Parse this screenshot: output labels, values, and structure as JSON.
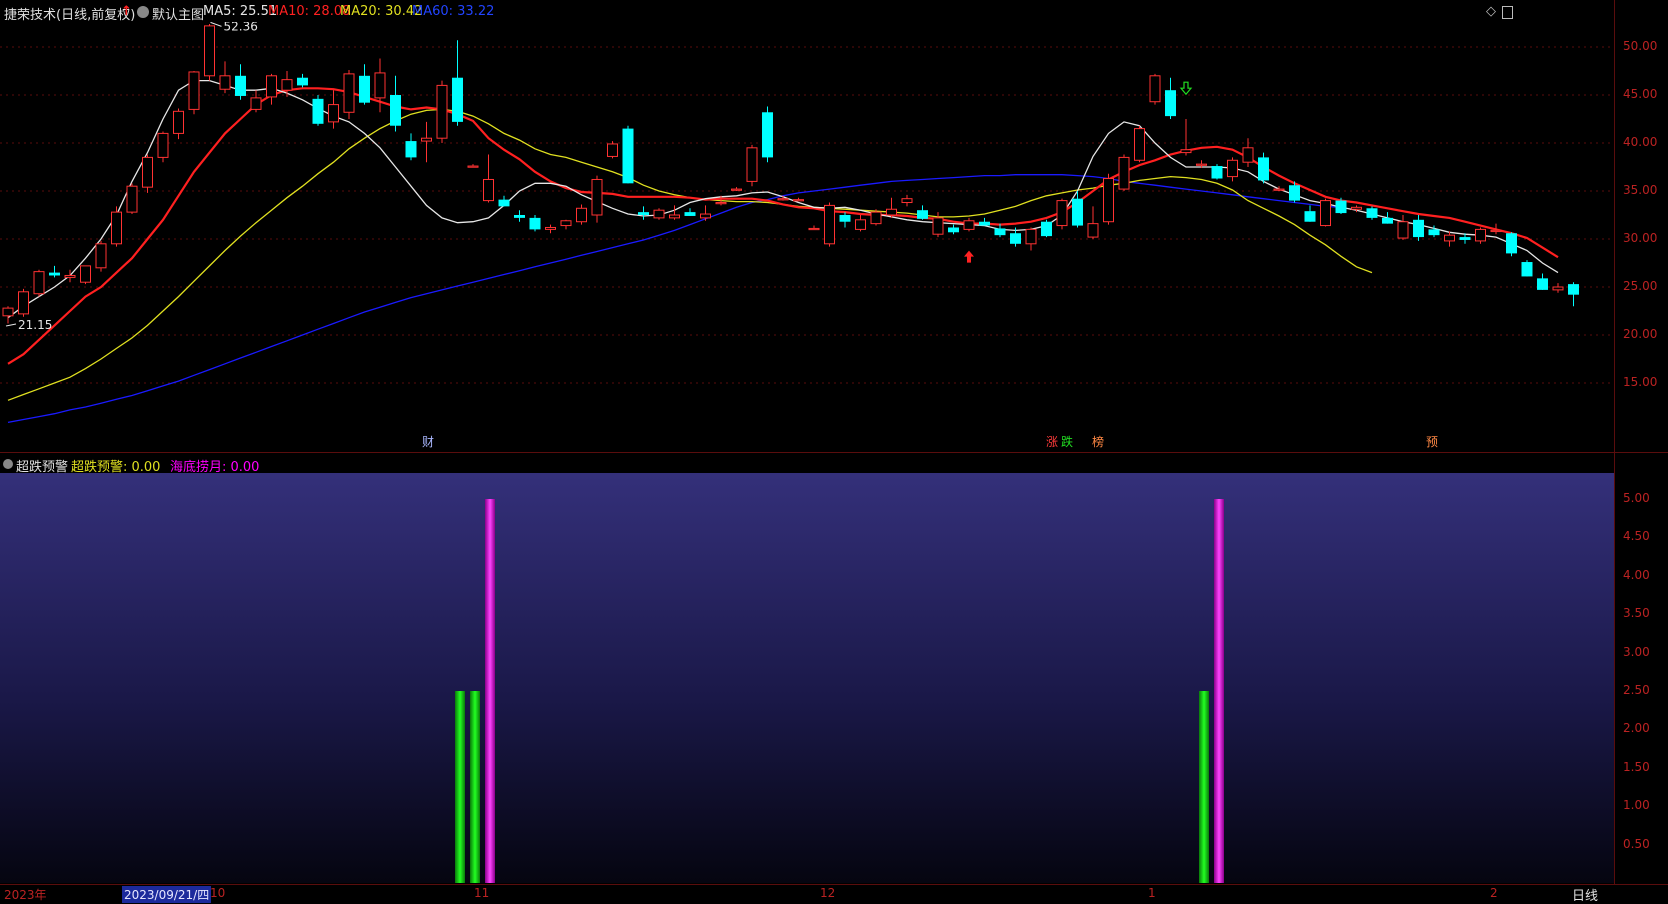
{
  "header": {
    "stock_title": "捷荣技术(日线,前复权)",
    "template_label": "默认主图",
    "ma5": "MA5: 25.51",
    "ma10": "MA10: 28.08",
    "ma20": "MA20: 30.42",
    "ma60": "MA60: 33.22"
  },
  "indicator": {
    "name": "超跌预警",
    "value1": "超跌预警: 0.00",
    "value2": "海底捞月: 0.00"
  },
  "right_axis": {
    "price_ticks": [
      "50.00",
      "45.00",
      "40.00",
      "35.00",
      "30.00",
      "25.00",
      "20.00",
      "15.00"
    ],
    "indicator_ticks": [
      "5.00",
      "4.50",
      "4.00",
      "3.50",
      "3.00",
      "2.50",
      "2.00",
      "1.50",
      "1.00",
      "0.50"
    ]
  },
  "bottom": {
    "year": "2023年",
    "cursor_date": "2023/09/21/四",
    "month_labels": [
      "10",
      "11",
      "12",
      "1",
      "2"
    ],
    "period": "日线"
  },
  "markers": {
    "high_label": "52.36",
    "low_label": "21.15",
    "event_cai": "财",
    "event_zhang": "涨",
    "event_die": "跌",
    "event_bang": "榜",
    "event_yu": "预"
  },
  "colors": {
    "up": "#ff3232",
    "down": "#00ffff",
    "ma5": "#e6e6e6",
    "ma10": "#ff2020",
    "ma20": "#e0e020",
    "ma60": "#1a1aff",
    "green_bar": "#00cc00",
    "magenta_bar": "#ff00ff"
  },
  "chart_data": {
    "type": "candlestick",
    "y_range": [
      10.5,
      55
    ],
    "candles": [
      [
        22,
        23,
        21.2,
        22.8
      ],
      [
        22.2,
        24.8,
        21.9,
        24.5
      ],
      [
        24.3,
        26.8,
        24,
        26.6
      ],
      [
        26.5,
        27.2,
        26,
        26.2
      ],
      [
        26,
        26.8,
        25.5,
        26.2
      ],
      [
        25.5,
        27.2,
        25.3,
        27.2
      ],
      [
        27,
        29.8,
        26.6,
        29.5
      ],
      [
        29.5,
        33.4,
        29.2,
        32.8
      ],
      [
        32.8,
        35.8,
        32.6,
        35.5
      ],
      [
        35.4,
        38.8,
        34.8,
        38.5
      ],
      [
        38.5,
        41.2,
        38,
        41
      ],
      [
        41,
        43.6,
        40.4,
        43.3
      ],
      [
        43.5,
        47.5,
        43,
        47.4
      ],
      [
        47,
        52.4,
        46.5,
        52.2
      ],
      [
        45.6,
        48.5,
        45.2,
        47
      ],
      [
        47,
        48.2,
        44.5,
        44.9
      ],
      [
        43.5,
        45.5,
        43.2,
        44.7
      ],
      [
        44.8,
        47.2,
        44,
        47
      ],
      [
        45.5,
        47.5,
        44.8,
        46.6
      ],
      [
        46.8,
        47.2,
        45.8,
        46
      ],
      [
        44.6,
        45,
        41.8,
        42
      ],
      [
        42.2,
        45.5,
        41.5,
        44
      ],
      [
        43.2,
        47.6,
        42.5,
        47.2
      ],
      [
        47,
        48.2,
        44,
        44.2
      ],
      [
        44.7,
        48.8,
        43.2,
        47.3
      ],
      [
        45,
        47,
        41.2,
        41.8
      ],
      [
        40.2,
        41,
        38.2,
        38.5
      ],
      [
        40.2,
        42.2,
        38,
        40.5
      ],
      [
        40.5,
        46.5,
        40,
        46
      ],
      [
        46.8,
        50.7,
        41.8,
        42.2
      ],
      [
        37.6,
        37.8,
        37.6,
        37.6
      ],
      [
        34,
        38.8,
        33.8,
        36.2
      ],
      [
        34.1,
        34.5,
        33.4,
        33.4
      ],
      [
        32.5,
        33,
        31.8,
        32.2
      ],
      [
        32.2,
        32.5,
        30.8,
        31
      ],
      [
        31,
        31.5,
        30.6,
        31.2
      ],
      [
        31.4,
        32,
        31,
        31.9
      ],
      [
        31.8,
        33.6,
        31.5,
        33.2
      ],
      [
        32.5,
        36.6,
        31.7,
        36.2
      ],
      [
        38.6,
        40.2,
        38.4,
        39.9
      ],
      [
        41.5,
        41.8,
        35.8,
        35.8
      ],
      [
        32.8,
        33.4,
        32,
        32.5
      ],
      [
        32.2,
        33.2,
        32,
        33
      ],
      [
        32.2,
        33.5,
        32,
        32.5
      ],
      [
        32.8,
        33.2,
        32.4,
        32.4
      ],
      [
        32.2,
        33.5,
        31.9,
        32.6
      ],
      [
        33.8,
        34.5,
        33.5,
        33.8
      ],
      [
        35.2,
        35.4,
        35,
        35.2
      ],
      [
        36,
        39.8,
        35.5,
        39.5
      ],
      [
        43.2,
        43.8,
        38,
        38.5
      ],
      [
        34.2,
        34.5,
        34,
        34.2
      ],
      [
        34.1,
        34.3,
        34,
        34.1
      ],
      [
        31.1,
        31.4,
        31,
        31.1
      ],
      [
        29.5,
        33.8,
        29.2,
        33.5
      ],
      [
        32.5,
        32.8,
        31.2,
        31.8
      ],
      [
        31,
        32.5,
        30.8,
        32
      ],
      [
        31.6,
        33.1,
        31.4,
        32.8
      ],
      [
        32.5,
        34.3,
        32.2,
        33.1
      ],
      [
        33.8,
        34.6,
        33.4,
        34.2
      ],
      [
        33,
        33.5,
        32,
        32.1
      ],
      [
        30.5,
        32.8,
        30.2,
        32.2
      ],
      [
        31.2,
        31.5,
        30.5,
        30.7
      ],
      [
        31,
        32.2,
        30.8,
        31.9
      ],
      [
        31.8,
        32.2,
        31.4,
        31.4
      ],
      [
        31.1,
        31.6,
        30.2,
        30.4
      ],
      [
        30.6,
        31.2,
        29.2,
        29.5
      ],
      [
        29.5,
        31.2,
        28.8,
        31
      ],
      [
        31.8,
        32,
        30.2,
        30.3
      ],
      [
        31.4,
        34.2,
        31,
        34
      ],
      [
        34.2,
        35,
        31.2,
        31.4
      ],
      [
        30.2,
        33.4,
        30,
        31.6
      ],
      [
        31.8,
        36.8,
        31.5,
        36.3
      ],
      [
        35.2,
        38.8,
        35,
        38.5
      ],
      [
        38.2,
        41.8,
        38,
        41.5
      ],
      [
        44.3,
        47.2,
        44,
        47
      ],
      [
        45.5,
        46.8,
        42.5,
        42.8
      ],
      [
        39,
        42.5,
        38.7,
        39.3
      ],
      [
        37.8,
        38.2,
        37.4,
        37.8
      ],
      [
        37.6,
        37.8,
        36.2,
        36.3
      ],
      [
        36.5,
        38.5,
        36,
        38.2
      ],
      [
        38,
        40.5,
        37.5,
        39.5
      ],
      [
        38.5,
        39,
        35.8,
        36.1
      ],
      [
        35.2,
        35.5,
        35,
        35.2
      ],
      [
        35.6,
        36,
        33.8,
        34
      ],
      [
        32.9,
        33.5,
        31.8,
        31.8
      ],
      [
        31.4,
        34.2,
        31.3,
        34
      ],
      [
        34,
        34.3,
        32.6,
        32.7
      ],
      [
        33.1,
        33.5,
        32.8,
        33.3
      ],
      [
        33.2,
        33.4,
        32,
        32.2
      ],
      [
        32.2,
        32.8,
        31.6,
        31.6
      ],
      [
        30.1,
        32.5,
        29.9,
        31.8
      ],
      [
        32,
        32.5,
        29.8,
        30.2
      ],
      [
        31,
        31.4,
        30.2,
        30.4
      ],
      [
        29.8,
        30.8,
        29.2,
        30.4
      ],
      [
        30.2,
        30.6,
        29.5,
        29.9
      ],
      [
        29.8,
        31.2,
        29.5,
        31
      ],
      [
        30.8,
        31.6,
        30.5,
        30.9
      ],
      [
        30.6,
        30.7,
        28.2,
        28.5
      ],
      [
        27.6,
        27.8,
        26.1,
        26.1
      ],
      [
        25.9,
        26.4,
        24.7,
        24.7
      ],
      [
        24.7,
        25.4,
        24.4,
        25
      ],
      [
        25.3,
        25.5,
        23,
        24.2
      ]
    ],
    "ma5": [
      21.8,
      23,
      24,
      25,
      26.2,
      28,
      30,
      32.5,
      36,
      39,
      42.5,
      45.5,
      46.5,
      46.5,
      46,
      45.5,
      45.5,
      45.7,
      45.2,
      44.5,
      43.6,
      42.8,
      42.2,
      41,
      39.5,
      37.5,
      35.5,
      33.5,
      32.2,
      31.7,
      31.8,
      32.2,
      33.5,
      35,
      35.8,
      35.8,
      35.5,
      34.6,
      33.9,
      33.2,
      32.6,
      32.4,
      32.5,
      33,
      33.8,
      34.2,
      34.4,
      34.5,
      34.8,
      34.9,
      34.4,
      33.8,
      33.3,
      33.2,
      33.3,
      33,
      32.6,
      32.3,
      32,
      31.8,
      31.7,
      31.6,
      31.5,
      31.4,
      31,
      30.9,
      31,
      31.4,
      32.5,
      35,
      38.6,
      41,
      42.2,
      41.8,
      40,
      38.5,
      37.5,
      37.5,
      37.5,
      37.4,
      37,
      36,
      35.2,
      34.6,
      34,
      33.7,
      33.3,
      33,
      32.6,
      32.2,
      31.8,
      31.5,
      31.1,
      30.7,
      30.5,
      30.4,
      30.2,
      29.5,
      28.8,
      27.5,
      26.5
    ],
    "ma10": [
      17,
      18,
      19.5,
      21,
      22.5,
      24,
      25,
      26.5,
      28,
      30,
      32,
      34.5,
      37,
      39,
      41,
      42.5,
      44,
      45,
      45.5,
      45.7,
      45.7,
      45.6,
      45.3,
      44.8,
      44.3,
      43.8,
      43.5,
      43.7,
      43.5,
      43,
      42.3,
      40.5,
      39.3,
      38.3,
      37,
      36,
      35.3,
      34.9,
      34.8,
      34.7,
      34.4,
      34.4,
      34.4,
      34.4,
      34.3,
      34.1,
      34.2,
      34.2,
      34.2,
      34,
      33.6,
      33.3,
      33.2,
      32.9,
      32.8,
      32.6,
      32.5,
      32.5,
      32.4,
      32.2,
      32.1,
      31.8,
      31.6,
      31.6,
      31.5,
      31.6,
      31.8,
      32.2,
      32.8,
      33.8,
      35,
      36.2,
      37,
      37.7,
      38.2,
      38.8,
      39.2,
      39.5,
      39.6,
      39.3,
      38.5,
      37.5,
      36.6,
      35.8,
      35.1,
      34.4,
      34,
      33.8,
      33.5,
      33.2,
      32.9,
      32.6,
      32.4,
      32.2,
      31.8,
      31.4,
      31,
      30.6,
      30.1,
      29.1,
      28.1
    ],
    "ma20": [
      13.2,
      13.8,
      14.4,
      15,
      15.6,
      16.5,
      17.5,
      18.6,
      19.7,
      21,
      22.5,
      24,
      25.6,
      27.2,
      28.8,
      30.3,
      31.7,
      33,
      34.3,
      35.5,
      36.8,
      38,
      39.4,
      40.5,
      41.5,
      42.3,
      43,
      43.4,
      43.5,
      43.3,
      42.8,
      42,
      41,
      40.3,
      39.4,
      38.8,
      38.5,
      38,
      37.5,
      37,
      36.4,
      35.6,
      35,
      34.6,
      34.3,
      34.1,
      34,
      33.9,
      33.9,
      33.8,
      33.6,
      33.4,
      33.3,
      33.2,
      33.1,
      33,
      32.9,
      32.8,
      32.7,
      32.5,
      32.3,
      32.3,
      32.4,
      32.6,
      33,
      33.4,
      34,
      34.5,
      34.8,
      35.1,
      35.3,
      35.6,
      35.8,
      36.1,
      36.3,
      36.5,
      36.4,
      36.2,
      35.8,
      35.1,
      34,
      33.2,
      32.4,
      31.5,
      30.4,
      29.4,
      28.2,
      27.1,
      26.5
    ],
    "ma60": [
      10.9,
      11.2,
      11.5,
      11.8,
      12.2,
      12.5,
      12.9,
      13.3,
      13.7,
      14.2,
      14.7,
      15.2,
      15.8,
      16.4,
      17,
      17.6,
      18.2,
      18.8,
      19.4,
      20,
      20.6,
      21.2,
      21.8,
      22.4,
      22.9,
      23.4,
      23.9,
      24.3,
      24.7,
      25.1,
      25.5,
      25.9,
      26.3,
      26.7,
      27.1,
      27.5,
      27.9,
      28.3,
      28.7,
      29.1,
      29.5,
      29.9,
      30.4,
      30.9,
      31.5,
      32.1,
      32.7,
      33.3,
      33.8,
      34.1,
      34.5,
      34.8,
      35,
      35.2,
      35.4,
      35.6,
      35.8,
      36,
      36.1,
      36.2,
      36.3,
      36.4,
      36.5,
      36.6,
      36.6,
      36.7,
      36.7,
      36.7,
      36.7,
      36.6,
      36.5,
      36.3,
      36,
      35.8,
      35.6,
      35.4,
      35.2,
      35,
      34.8,
      34.6,
      34.4,
      34.2,
      34,
      33.8,
      33.6,
      33.4,
      33.3
    ]
  },
  "indicator_data": {
    "type": "bar",
    "y_range": [
      0,
      5
    ],
    "bars": [
      {
        "series": "超跌预警",
        "color": "green",
        "value": 2.5
      },
      {
        "series": "超跌预警",
        "color": "green",
        "value": 2.5
      },
      {
        "series": "海底捞月",
        "color": "magenta",
        "value": 5.0
      },
      {
        "series": "超跌预警",
        "color": "green",
        "value": 2.5
      },
      {
        "series": "海底捞月",
        "color": "magenta",
        "value": 5.0
      }
    ]
  }
}
